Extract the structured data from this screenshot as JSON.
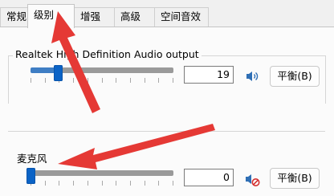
{
  "tabs": [
    {
      "label": "常规"
    },
    {
      "label": "级别"
    },
    {
      "label": "增强"
    },
    {
      "label": "高级"
    },
    {
      "label": "空间音效"
    }
  ],
  "active_tab": "级别",
  "output": {
    "label": "Realtek High Definition Audio output",
    "level": 19,
    "level_text": "19",
    "balance_label": "平衡(B)",
    "speaker_icon": "speaker-icon",
    "muted": false
  },
  "microphone": {
    "label": "麦克风",
    "level": 0,
    "level_text": "0",
    "balance_label": "平衡(B)",
    "speaker_icon": "speaker-muted-icon",
    "muted": true
  },
  "annotation": {
    "arrow_color": "#e53935"
  },
  "colors": {
    "accent": "#0b63c6",
    "slider_fill": "#3f7ec4"
  }
}
